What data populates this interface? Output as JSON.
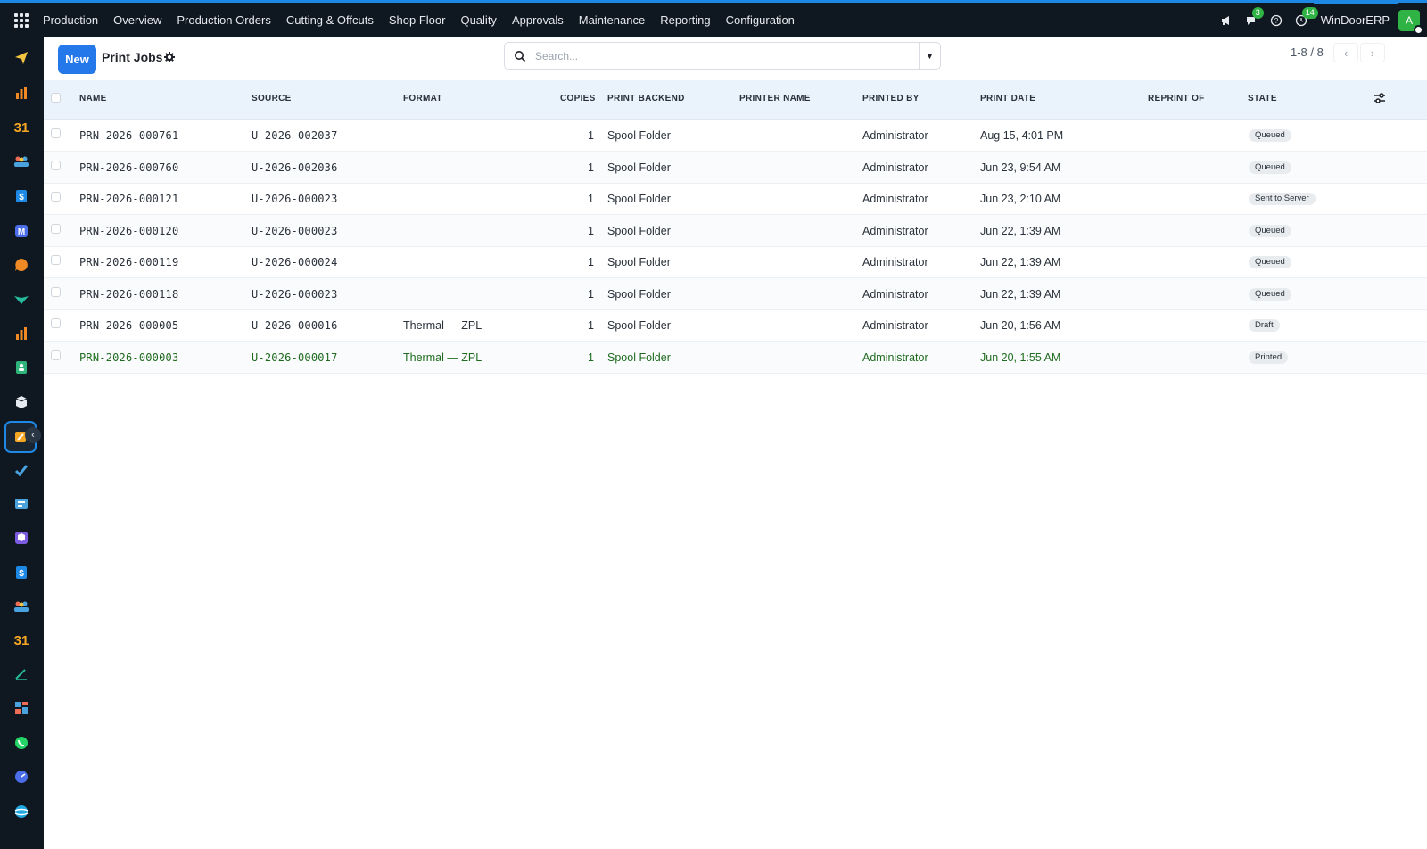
{
  "topbar": {
    "nav": [
      "Production",
      "Overview",
      "Production Orders",
      "Cutting & Offcuts",
      "Shop Floor",
      "Quality",
      "Approvals",
      "Maintenance",
      "Reporting",
      "Configuration"
    ],
    "chat_badge": "3",
    "activity_badge": "14",
    "brand": "WinDoorERP",
    "avatar_initial": "A"
  },
  "page": {
    "new_label": "New",
    "title": "Print Jobs",
    "search_placeholder": "Search...",
    "pager": "1-8 / 8"
  },
  "table": {
    "columns": [
      "NAME",
      "SOURCE",
      "FORMAT",
      "COPIES",
      "PRINT BACKEND",
      "PRINTER NAME",
      "PRINTED BY",
      "PRINT DATE",
      "REPRINT OF",
      "STATE"
    ],
    "rows": [
      {
        "name": "PRN-2026-000761",
        "source": "U-2026-002037",
        "format": "",
        "copies": "1",
        "backend": "Spool Folder",
        "printer": "",
        "printed_by": "Administrator",
        "date": "Aug 15, 4:01 PM",
        "reprint_of": "",
        "state": "Queued"
      },
      {
        "name": "PRN-2026-000760",
        "source": "U-2026-002036",
        "format": "",
        "copies": "1",
        "backend": "Spool Folder",
        "printer": "",
        "printed_by": "Administrator",
        "date": "Jun 23, 9:54 AM",
        "reprint_of": "",
        "state": "Queued"
      },
      {
        "name": "PRN-2026-000121",
        "source": "U-2026-000023",
        "format": "",
        "copies": "1",
        "backend": "Spool Folder",
        "printer": "",
        "printed_by": "Administrator",
        "date": "Jun 23, 2:10 AM",
        "reprint_of": "",
        "state": "Sent to Server"
      },
      {
        "name": "PRN-2026-000120",
        "source": "U-2026-000023",
        "format": "",
        "copies": "1",
        "backend": "Spool Folder",
        "printer": "",
        "printed_by": "Administrator",
        "date": "Jun 22, 1:39 AM",
        "reprint_of": "",
        "state": "Queued"
      },
      {
        "name": "PRN-2026-000119",
        "source": "U-2026-000024",
        "format": "",
        "copies": "1",
        "backend": "Spool Folder",
        "printer": "",
        "printed_by": "Administrator",
        "date": "Jun 22, 1:39 AM",
        "reprint_of": "",
        "state": "Queued"
      },
      {
        "name": "PRN-2026-000118",
        "source": "U-2026-000023",
        "format": "",
        "copies": "1",
        "backend": "Spool Folder",
        "printer": "",
        "printed_by": "Administrator",
        "date": "Jun 22, 1:39 AM",
        "reprint_of": "",
        "state": "Queued"
      },
      {
        "name": "PRN-2026-000005",
        "source": "U-2026-000016",
        "format": "Thermal — ZPL",
        "copies": "1",
        "backend": "Spool Folder",
        "printer": "",
        "printed_by": "Administrator",
        "date": "Jun 20, 1:56 AM",
        "reprint_of": "",
        "state": "Draft"
      },
      {
        "name": "PRN-2026-000003",
        "source": "U-2026-000017",
        "format": "Thermal — ZPL",
        "copies": "1",
        "backend": "Spool Folder",
        "printer": "",
        "printed_by": "Administrator",
        "date": "Jun 20, 1:55 AM",
        "reprint_of": "",
        "state": "Printed"
      }
    ]
  },
  "colors": {
    "topbar_bg": "#0f1720",
    "accent": "#2478ea",
    "header_row_bg": "#eaf3fc",
    "printed_row_text": "#1f6b1f",
    "badge_bg": "#e9ecef"
  },
  "sidebar_icons": [
    "send-icon",
    "bar-chart-icon",
    "calendar-31-icon",
    "team-icon",
    "dollar-doc-icon",
    "mail-m-icon",
    "chat-bubble-icon",
    "check-shield-icon",
    "bar-chart-icon",
    "contact-book-icon",
    "box-icon",
    "print-jobs-icon",
    "checkmark-icon",
    "reader-icon",
    "cube-icon",
    "dollar-doc-icon",
    "team-icon",
    "calendar-31-icon",
    "pen-icon",
    "dashboard-icon",
    "whatsapp-icon",
    "gauge-icon",
    "globe-icon"
  ]
}
